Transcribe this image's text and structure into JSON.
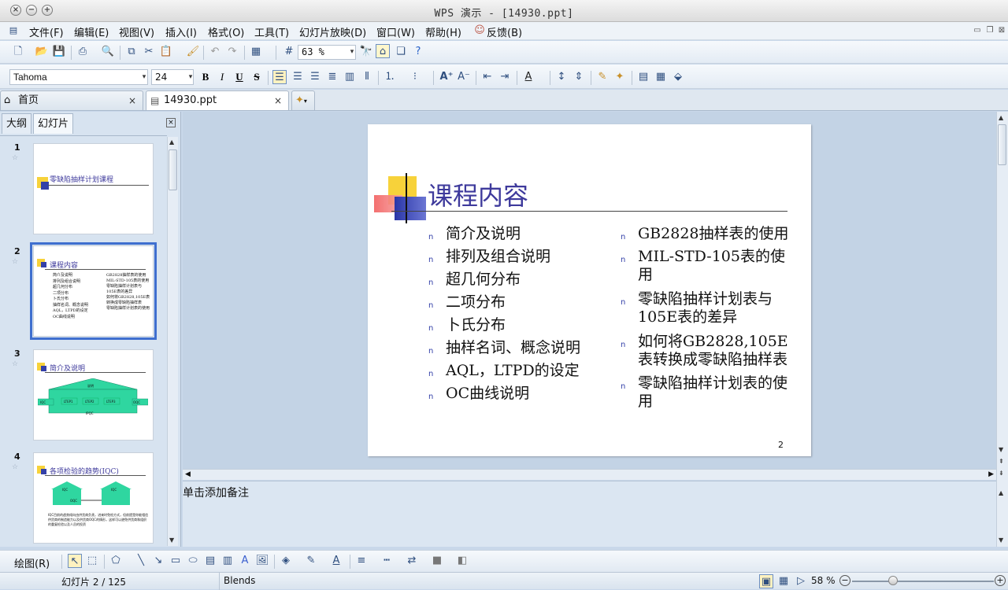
{
  "window": {
    "title": "WPS 演示 - [14930.ppt]"
  },
  "menu": [
    "文件(F)",
    "编辑(E)",
    "视图(V)",
    "插入(I)",
    "格式(O)",
    "工具(T)",
    "幻灯片放映(D)",
    "窗口(W)",
    "帮助(H)",
    "反馈(B)"
  ],
  "toolbar": {
    "zoom": "63 %"
  },
  "format": {
    "font": "Tahoma",
    "size": "24",
    "bold": "B",
    "italic": "I",
    "underline": "U",
    "shadow": "S"
  },
  "tabs": [
    {
      "label": "首页"
    },
    {
      "label": "14930.ppt"
    }
  ],
  "panel": {
    "tab_outline": "大纲",
    "tab_slides": "幻灯片"
  },
  "thumbnails": [
    {
      "num": "1",
      "title": "零缺陷抽样计划课程"
    },
    {
      "num": "2",
      "title": "课程内容",
      "col1": [
        "简介及说明",
        "排列及组合说明",
        "超几何分布",
        "二项分布",
        "卜氏分布",
        "抽样名词、概念说明",
        "AQL，LTPD的设定",
        "OC曲线说明"
      ],
      "col2": [
        "GB2828抽样表的使用",
        "MIL-STD-105表的使用",
        "零缺陷抽样计划表与105E表的差异",
        "如何将GB2828,105E表转换成零缺陷抽样表",
        "零缺陷抽样计划表的使用"
      ]
    },
    {
      "num": "3",
      "title": "简介及说明",
      "labels": [
        "说明",
        "IQC",
        "LTEP1",
        "LTEP2",
        "LTEP3",
        "OQC",
        "IPQC"
      ]
    },
    {
      "num": "4",
      "title": "各项检验的趋势(IQC)",
      "labels": [
        "IQC",
        "IQC",
        "OQC"
      ],
      "text": "IQC目前的趋势倾向由供货商负责，进来时免检方式，但前提是你能相信供货商的制造能力以及供货商OQC的情形，这样可以避免供货商和组织的重复检验以及人员的投资"
    }
  ],
  "slide": {
    "title": "课程内容",
    "bullet_mark": "n",
    "left": [
      "简介及说明",
      "排列及组合说明",
      "超几何分布",
      "二项分布",
      "卜氏分布",
      "抽样名词、概念说明",
      "AQL，LTPD的设定",
      "OC曲线说明"
    ],
    "right": [
      "GB2828抽样表的使用",
      "MIL-STD-105表的使用",
      "零缺陷抽样计划表与105E表的差异",
      "如何将GB2828,105E表转换成零缺陷抽样表",
      "零缺陷抽样计划表的使用"
    ],
    "page": "2"
  },
  "notes": {
    "placeholder": "单击添加备注"
  },
  "drawbar": {
    "label": "绘图(R)"
  },
  "status": {
    "slide": "幻灯片 2 / 125",
    "template": "Blends",
    "zoom": "58 %"
  }
}
